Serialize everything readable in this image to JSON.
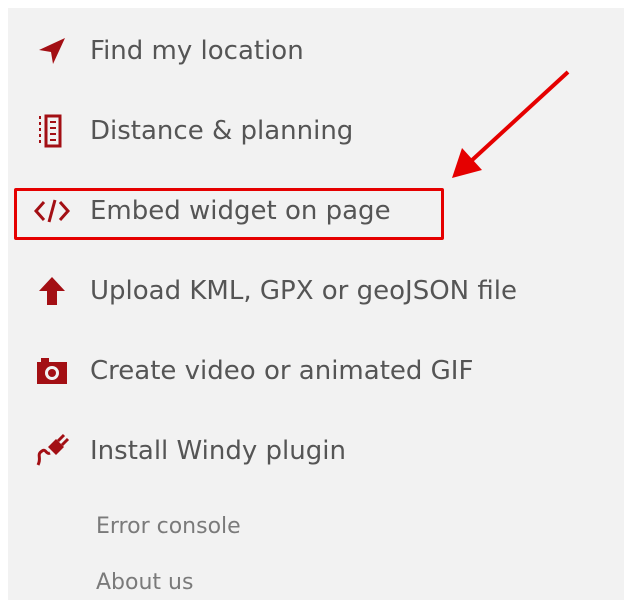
{
  "menu": {
    "items": [
      {
        "label": "Find my location",
        "icon": "location-arrow-icon"
      },
      {
        "label": "Distance & planning",
        "icon": "ruler-icon"
      },
      {
        "label": "Embed widget on page",
        "icon": "code-icon"
      },
      {
        "label": "Upload KML, GPX or geoJSON file",
        "icon": "upload-arrow-icon"
      },
      {
        "label": "Create video or animated GIF",
        "icon": "camera-icon"
      },
      {
        "label": "Install Windy plugin",
        "icon": "plug-icon"
      }
    ],
    "sublinks": [
      {
        "label": "Error console"
      },
      {
        "label": "About us"
      }
    ]
  },
  "colors": {
    "icon": "#a30f14",
    "text": "#555555",
    "sublink": "#7a7a7a",
    "highlight": "#e50000",
    "panel": "#f2f2f2"
  }
}
